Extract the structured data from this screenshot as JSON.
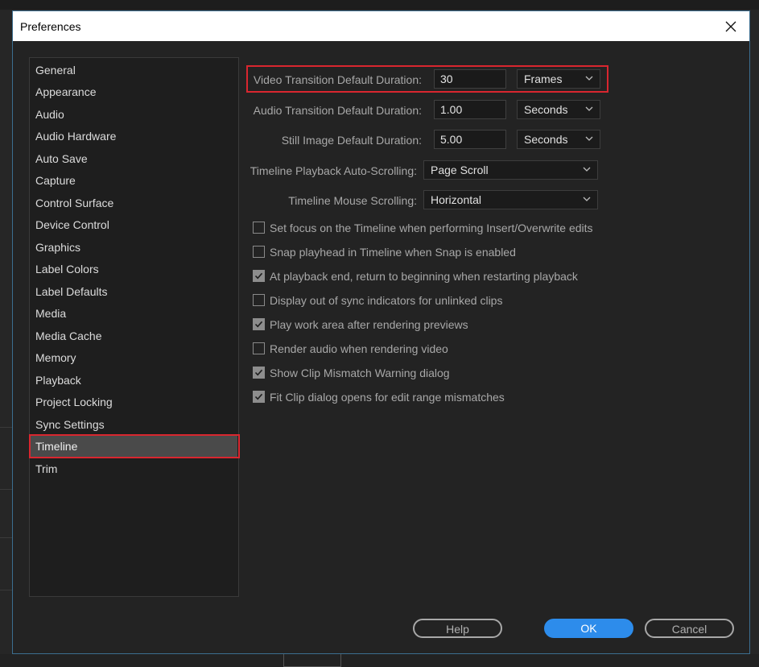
{
  "window": {
    "title": "Preferences"
  },
  "categories": [
    {
      "label": "General"
    },
    {
      "label": "Appearance"
    },
    {
      "label": "Audio"
    },
    {
      "label": "Audio Hardware"
    },
    {
      "label": "Auto Save"
    },
    {
      "label": "Capture"
    },
    {
      "label": "Control Surface"
    },
    {
      "label": "Device Control"
    },
    {
      "label": "Graphics"
    },
    {
      "label": "Label Colors"
    },
    {
      "label": "Label Defaults"
    },
    {
      "label": "Media"
    },
    {
      "label": "Media Cache"
    },
    {
      "label": "Memory"
    },
    {
      "label": "Playback"
    },
    {
      "label": "Project Locking"
    },
    {
      "label": "Sync Settings"
    },
    {
      "label": "Timeline",
      "selected": true
    },
    {
      "label": "Trim"
    }
  ],
  "settings": {
    "video_transition": {
      "label": "Video Transition Default Duration:",
      "value": "30",
      "unit": "Frames"
    },
    "audio_transition": {
      "label": "Audio Transition Default Duration:",
      "value": "1.00",
      "unit": "Seconds"
    },
    "still_image": {
      "label": "Still Image Default Duration:",
      "value": "5.00",
      "unit": "Seconds"
    },
    "auto_scrolling": {
      "label": "Timeline Playback Auto-Scrolling:",
      "value": "Page Scroll"
    },
    "mouse_scrolling": {
      "label": "Timeline Mouse Scrolling:",
      "value": "Horizontal"
    }
  },
  "checkboxes": [
    {
      "label": "Set focus on the Timeline when performing Insert/Overwrite edits",
      "checked": false
    },
    {
      "label": "Snap playhead in Timeline when Snap is enabled",
      "checked": false
    },
    {
      "label": "At playback end, return to beginning when restarting playback",
      "checked": true
    },
    {
      "label": "Display out of sync indicators for unlinked clips",
      "checked": false
    },
    {
      "label": "Play work area after rendering previews",
      "checked": true
    },
    {
      "label": "Render audio when rendering video",
      "checked": false
    },
    {
      "label": "Show Clip Mismatch Warning dialog",
      "checked": true
    },
    {
      "label": "Fit Clip dialog opens for edit range mismatches",
      "checked": true
    }
  ],
  "buttons": {
    "help": "Help",
    "ok": "OK",
    "cancel": "Cancel"
  },
  "colors": {
    "accent": "#2d8ceb",
    "highlight": "#d9262f",
    "selected_bg": "#4a4a4a"
  },
  "icons": {
    "close": "close-icon",
    "dropdown": "chevron-down-icon",
    "check": "checkmark-icon"
  }
}
